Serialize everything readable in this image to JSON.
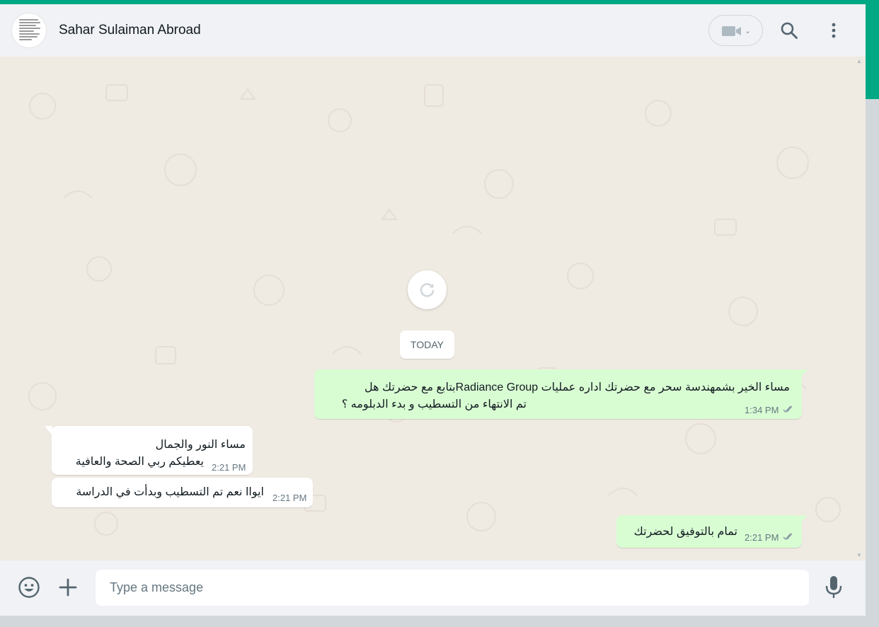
{
  "header": {
    "contact_name": "Sahar Sulaiman Abroad",
    "video_icon": "video-camera-icon",
    "video_dropdown_icon": "chevron-down-icon",
    "search_icon": "search-icon",
    "menu_icon": "more-vertical-icon"
  },
  "chat": {
    "refresh_icon": "refresh-icon",
    "date_separator": "TODAY",
    "messages": [
      {
        "direction": "outgoing",
        "lines": [
          "مساء الخير بشمهندسة سحر  مع  حضرتك اداره عمليات Radiance Groupبتابع مع حضرتك هل",
          "تم الانتهاء من التسطيب و بدء الدبلومه ؟"
        ],
        "time": "1:34 PM",
        "status": "read"
      },
      {
        "direction": "incoming",
        "lines": [
          "مساء النور والجمال",
          "يعطيكم ربي الصحة والعافية"
        ],
        "time": "2:21 PM"
      },
      {
        "direction": "incoming",
        "lines": [
          "ايواا نعم تم التسطيب وبدأت في الدراسة"
        ],
        "time": "2:21 PM"
      },
      {
        "direction": "outgoing",
        "lines": [
          "تمام بالتوفيق لحضرتك"
        ],
        "time": "2:21 PM",
        "status": "read"
      }
    ]
  },
  "composer": {
    "placeholder": "Type a message",
    "value": "",
    "emoji_icon": "emoji-icon",
    "attach_icon": "plus-icon",
    "mic_icon": "microphone-icon"
  },
  "colors": {
    "accent": "#00a884",
    "outgoing_bubble": "#d9fdd3",
    "incoming_bubble": "#ffffff",
    "chat_background": "#efeae2",
    "read_ticks": "#8696a0"
  }
}
